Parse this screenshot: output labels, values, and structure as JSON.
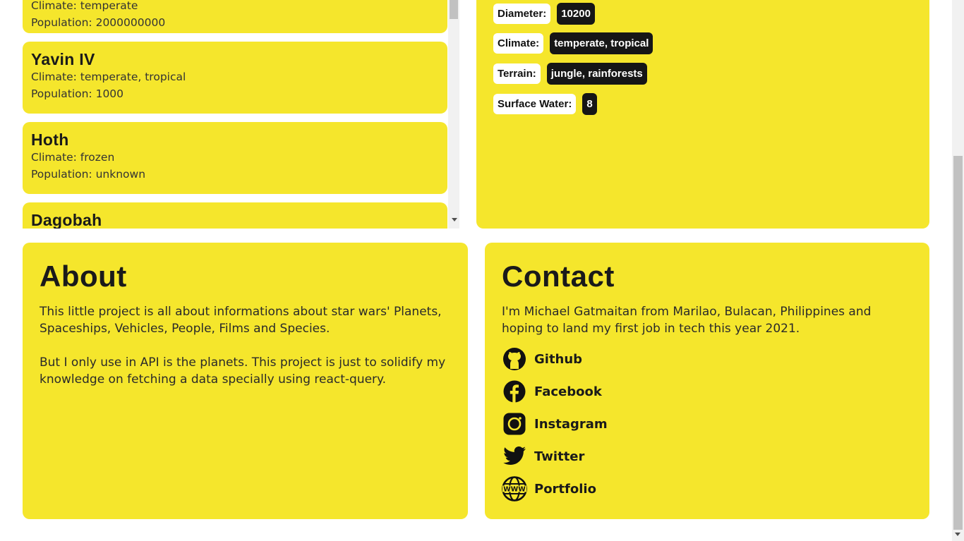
{
  "planets": [
    {
      "name": "",
      "climate_line": "Climate: temperate",
      "population_line": "Population: 2000000000"
    },
    {
      "name": "Yavin IV",
      "climate_line": "Climate: temperate, tropical",
      "population_line": "Population: 1000"
    },
    {
      "name": "Hoth",
      "climate_line": "Climate: frozen",
      "population_line": "Population: unknown"
    },
    {
      "name": "Dagobah",
      "climate_line": "",
      "population_line": ""
    }
  ],
  "details": {
    "rows": [
      {
        "label": "Diameter:",
        "value": "10200"
      },
      {
        "label": "Climate:",
        "value": "temperate, tropical"
      },
      {
        "label": "Terrain:",
        "value": "jungle, rainforests"
      },
      {
        "label": "Surface Water:",
        "value": "8"
      }
    ]
  },
  "about": {
    "title": "About",
    "p1": "This little project is all about informations about star wars' Planets, Spaceships, Vehicles, People, Films and Species.",
    "p2": "But I only use in API is the planets. This project is just to solidify my knowledge on fetching a data specially using react-query."
  },
  "contact": {
    "title": "Contact",
    "intro": "I'm Michael Gatmaitan from Marilao, Bulacan, Philippines and hoping to land my first job in tech this year 2021.",
    "links": [
      {
        "label": "Github",
        "icon": "github-icon"
      },
      {
        "label": "Facebook",
        "icon": "facebook-icon"
      },
      {
        "label": "Instagram",
        "icon": "instagram-icon"
      },
      {
        "label": "Twitter",
        "icon": "twitter-icon"
      },
      {
        "label": "Portfolio",
        "icon": "www-icon"
      }
    ]
  },
  "colors": {
    "card": "#f5e62c",
    "tag_dark": "#161616",
    "text": "#1a1a1a"
  }
}
